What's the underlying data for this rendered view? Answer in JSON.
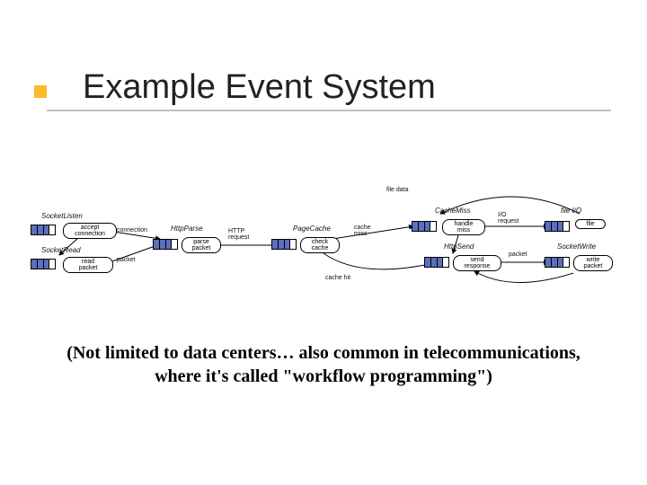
{
  "title": "Example Event System",
  "caption": "(Not limited to data centers… also common in telecommunications, where it's called \"workflow programming\")",
  "diagram": {
    "modules": {
      "socketListen": "SocketListen",
      "socketRead": "SocketRead",
      "httpParse": "HttpParse",
      "pageCache": "PageCache",
      "cacheMiss": "CacheMiss",
      "fileIO": "file I/O",
      "httpSend": "HttpSend",
      "socketWrite": "SocketWrite"
    },
    "events": {
      "acceptConn": "accept\nconnection",
      "readPacket": "read\npacket",
      "parsePacket": "parse\npacket",
      "checkCache": "check\ncache",
      "handleMiss": "handle\nmiss",
      "file": "file",
      "sendResponse": "send\nresponse",
      "writePacket": "write\npacket"
    },
    "labels": {
      "connection": "connection",
      "packet1": "packet",
      "httpRequest": "HTTP\nrequest",
      "cacheMissEdge": "cache\nmiss",
      "cacheHit": "cache hit",
      "ioRequest": "I/O\nrequest",
      "fileData": "file data",
      "packet2": "packet"
    }
  }
}
